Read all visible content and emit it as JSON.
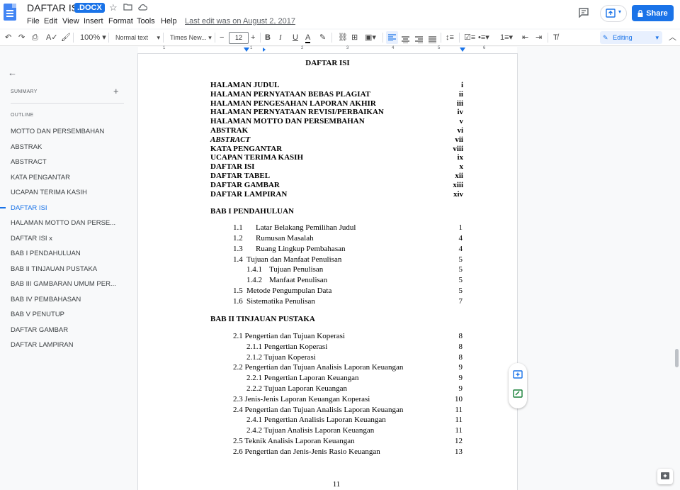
{
  "app": {
    "title": "DAFTAR ISI",
    "badge": ".DOCX",
    "last_edit": "Last edit was on August 2, 2017",
    "share_label": "Share",
    "menus": [
      "File",
      "Edit",
      "View",
      "Insert",
      "Format",
      "Tools",
      "Help"
    ]
  },
  "toolbar": {
    "zoom": "100%",
    "style": "Normal text",
    "font": "Times New...",
    "font_size": "12",
    "mode": "Editing"
  },
  "ruler": {
    "numbers": [
      "1",
      "1",
      "2",
      "3",
      "4",
      "5",
      "6"
    ]
  },
  "sidebar": {
    "summary_label": "SUMMARY",
    "outline_label": "OUTLINE",
    "active_index": 5,
    "items": [
      "MOTTO DAN PERSEMBAHAN",
      "ABSTRAK",
      "ABSTRACT",
      "KATA PENGANTAR",
      "UCAPAN TERIMA KASIH",
      "DAFTAR ISI",
      "HALAMAN MOTTO DAN PERSE...",
      "DAFTAR ISI x",
      "BAB I PENDAHULUAN",
      "BAB II TINJAUAN PUSTAKA",
      "BAB III GAMBARAN UMUM PER...",
      "BAB IV PEMBAHASAN",
      "BAB V PENUTUP",
      "DAFTAR GAMBAR",
      "DAFTAR LAMPIRAN"
    ]
  },
  "document": {
    "heading": "DAFTAR ISI",
    "front_matter": [
      {
        "text": "HALAMAN JUDUL",
        "page": "i"
      },
      {
        "text": "HALAMAN PERNYATAAN BEBAS PLAGIAT",
        "page": "ii"
      },
      {
        "text": "HALAMAN PENGESAHAN LAPORAN AKHIR",
        "page": "iii"
      },
      {
        "text": "HALAMAN PERNYATAAN REVISI/PERBAIKAN",
        "page": "iv"
      },
      {
        "text": "HALAMAN MOTTO DAN PERSEMBAHAN",
        "page": "v"
      },
      {
        "text": "ABSTRAK",
        "page": "vi"
      },
      {
        "text": "ABSTRACT",
        "page": "vii"
      },
      {
        "text": "KATA PENGANTAR",
        "page": "viii"
      },
      {
        "text": "UCAPAN TERIMA KASIH",
        "page": "ix"
      },
      {
        "text": "DAFTAR ISI",
        "page": "x"
      },
      {
        "text": "DAFTAR TABEL",
        "page": "xii"
      },
      {
        "text": "DAFTAR GAMBAR",
        "page": "xiii"
      },
      {
        "text": "DAFTAR LAMPIRAN",
        "page": "xiv"
      }
    ],
    "bab1": {
      "title": "BAB I PENDAHULUAN",
      "entries": [
        {
          "num": "1.1",
          "text": "Latar Belakang Pemilihan Judul",
          "page": "1"
        },
        {
          "num": "1.2",
          "text": "Rumusan Masalah",
          "page": "4"
        },
        {
          "num": "1.3",
          "text": "Ruang Lingkup Pembahasan",
          "page": "4"
        },
        {
          "num": "1.4",
          "text": "Tujuan dan Manfaat Penulisan",
          "page": "5"
        },
        {
          "num": "1.4.1",
          "text": "Tujuan Penulisan",
          "page": "5"
        },
        {
          "num": "1.4.2",
          "text": "Manfaat Penulisan",
          "page": "5"
        },
        {
          "num": "1.5",
          "text": "Metode Pengumpulan Data",
          "page": "5"
        },
        {
          "num": "1.6",
          "text": "Sistematika Penulisan",
          "page": "7"
        }
      ]
    },
    "bab2": {
      "title": "BAB II TINJAUAN PUSTAKA",
      "entries": [
        {
          "text": "2.1 Pengertian dan Tujuan Koperasi",
          "page": "8"
        },
        {
          "text": "2.1.1 Pengertian Koperasi",
          "page": "8"
        },
        {
          "text": "2.1.2 Tujuan Koperasi",
          "page": "8"
        },
        {
          "text": "2.2 Pengertian dan Tujuan Analisis Laporan Keuangan",
          "page": "9"
        },
        {
          "text": "2.2.1 Pengertian Laporan Keuangan",
          "page": "9"
        },
        {
          "text": "2.2.2 Tujuan Laporan Keuangan",
          "page": "9"
        },
        {
          "text": "2.3 Jenis-Jenis Laporan Keuangan Koperasi",
          "page": "10"
        },
        {
          "text": "2.4 Pengertian dan Tujuan Analisis Laporan Keuangan",
          "page": "11"
        },
        {
          "text": "2.4.1 Pengertian Analisis Laporan Keuangan",
          "page": "11"
        },
        {
          "text": "2.4.2 Tujuan Analisis Laporan Keuangan",
          "page": "11"
        },
        {
          "text": "2.5 Teknik Analisis Laporan Keuangan",
          "page": "12"
        },
        {
          "text": "2.6 Pengertian dan Jenis-Jenis Rasio Keuangan",
          "page": "13"
        }
      ]
    },
    "page_number": "11"
  },
  "colors": {
    "accent": "#1a73e8",
    "doc_icon": "#4285f4"
  }
}
